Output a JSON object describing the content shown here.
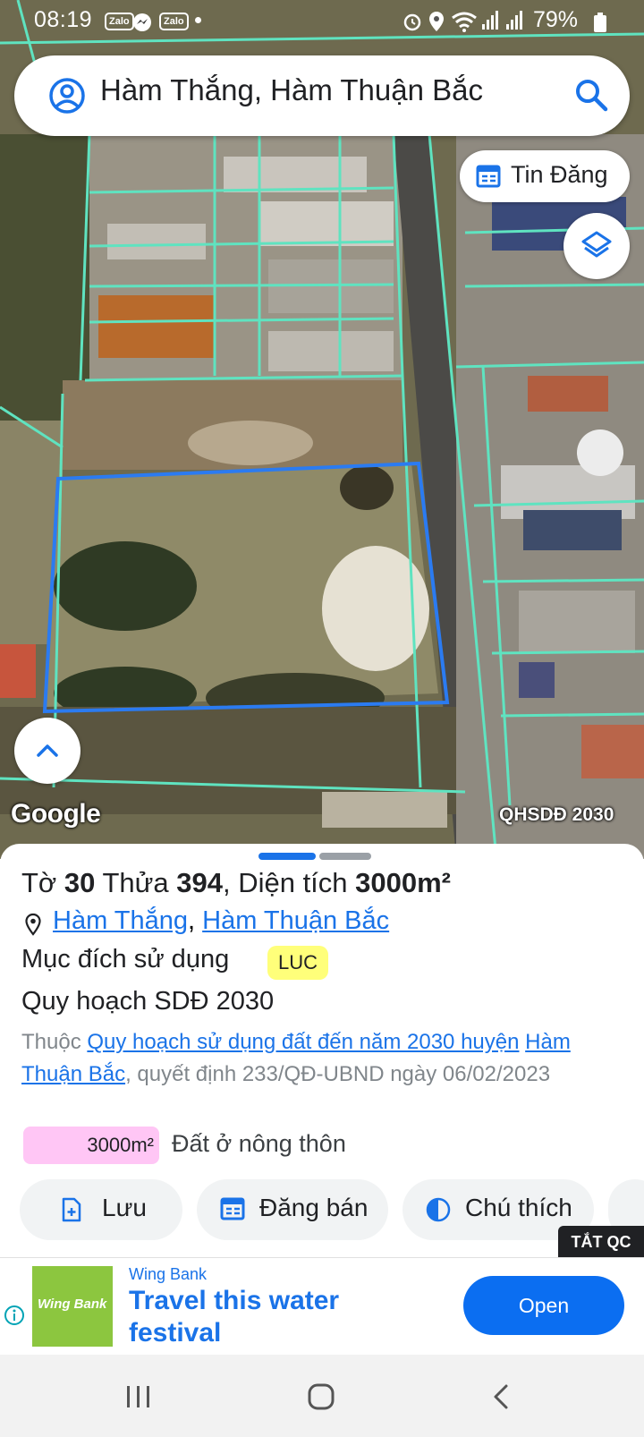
{
  "status_bar": {
    "time": "08:19",
    "apps": [
      "Zalo",
      "Zalo"
    ],
    "battery": "79%"
  },
  "search": {
    "query": "Hàm Thắng, Hàm Thuận Bắc"
  },
  "map": {
    "tin_dang_label": "Tin Đăng",
    "attribution": "Google",
    "layer_label": "QHSDĐ 2030",
    "parcel_outline_color": "#2b7bf1",
    "boundary_color": "#5fe3c0"
  },
  "parcel": {
    "sheet_label": "Tờ",
    "sheet_number": "30",
    "plot_label": "Thửa",
    "plot_number": "394",
    "area_label": ", Diện tích",
    "area_value": "3000m²",
    "comma": ",",
    "location_commune": "Hàm Thắng",
    "location_district": "Hàm Thuận Bắc",
    "purpose_label": "Mục đích sử dụng",
    "purpose_code": "LUC",
    "plan_title": "Quy hoạch SDĐ 2030",
    "plan_prefix": "Thuộc",
    "plan_link_1": "Quy hoạch sử dụng đất đến năm 2030 huyện",
    "plan_link_2": "Hàm Thuận Bắc",
    "plan_suffix": ", quyết định 233/QĐ-UBND ngày 06/02/2023",
    "zone_area": "3000m²",
    "zone_label": "Đất ở nông thôn",
    "zone_color": "#ffc6f5"
  },
  "actions": {
    "save": "Lưu",
    "post_sale": "Đăng bán",
    "legend": "Chú thích"
  },
  "ad": {
    "close_label": "TẮT QC",
    "brand": "Wing Bank",
    "logo_text": "Wing Bank",
    "headline": "Travel this water festival",
    "cta": "Open",
    "accent": "#0b6ef1"
  }
}
